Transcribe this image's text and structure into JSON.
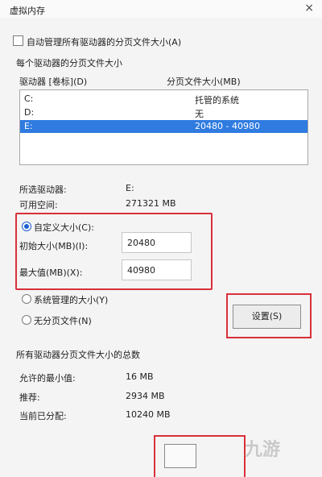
{
  "window": {
    "title": "虚拟内存",
    "close_glyph": "×"
  },
  "auto_manage": {
    "label": "自动管理所有驱动器的分页文件大小(A)",
    "checked": false
  },
  "drives_group": {
    "title": "每个驱动器的分页文件大小",
    "col_drive": "驱动器 [卷标](D)",
    "col_size": "分页文件大小(MB)",
    "rows": [
      {
        "drive": "C:",
        "size": "托管的系统"
      },
      {
        "drive": "D:",
        "size": "无"
      },
      {
        "drive": "E:",
        "size": "20480 - 40980",
        "selected": true
      }
    ]
  },
  "selected_info": {
    "drive_label": "所选驱动器:",
    "drive_value": "E:",
    "space_label": "可用空间:",
    "space_value": "271321 MB"
  },
  "custom_size": {
    "label": "自定义大小(C):",
    "initial_label": "初始大小(MB)(I):",
    "initial_value": "20480",
    "max_label": "最大值(MB)(X):",
    "max_value": "40980"
  },
  "system_managed": {
    "label": "系统管理的大小(Y)"
  },
  "no_paging": {
    "label": "无分页文件(N)"
  },
  "set_button": {
    "label": "设置(S)"
  },
  "total_group": {
    "title": "所有驱动器分页文件大小的总数",
    "min_label": "允许的最小值:",
    "min_value": "16 MB",
    "rec_label": "推荐:",
    "rec_value": "2934 MB",
    "cur_label": "当前已分配:",
    "cur_value": "10240 MB"
  },
  "watermark": {
    "text": "九游"
  },
  "colors": {
    "highlight": "#2f7be0",
    "annotation_red": "#d9303a",
    "radio_blue": "#1c5fd0"
  }
}
